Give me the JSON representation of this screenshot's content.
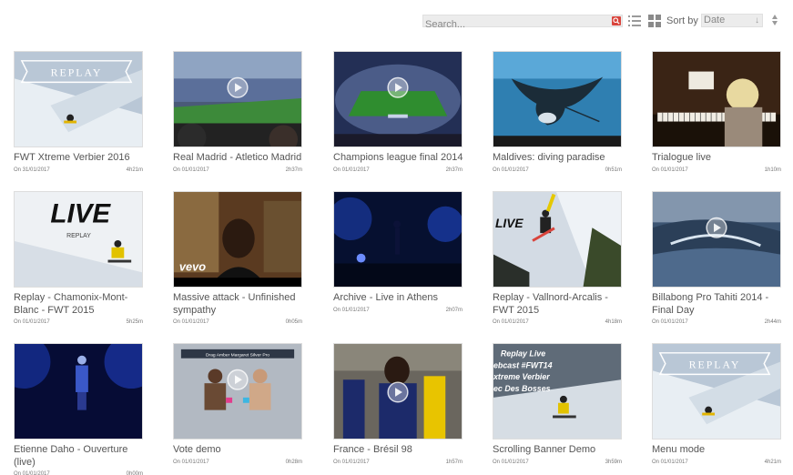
{
  "toolbar": {
    "search_placeholder": "Search...",
    "sort_label": "Sort by",
    "sort_value": "Date",
    "search_icon": "search-icon",
    "list_icon": "list-view-icon",
    "grid_icon": "grid-view-icon",
    "order_icon": "sort-order-icon",
    "accent": "#d9443c"
  },
  "videos": [
    {
      "title": "FWT Xtreme Verbier 2016",
      "date": "On 31/01/2017",
      "duration": "4h21m",
      "thumb": "ski-replay"
    },
    {
      "title": "Real Madrid - Atletico Madrid",
      "date": "On 01/01/2017",
      "duration": "2h37m",
      "thumb": "stadium"
    },
    {
      "title": "Champions league final 2014",
      "date": "On 01/01/2017",
      "duration": "2h37m",
      "thumb": "stadium-field"
    },
    {
      "title": "Maldives: diving paradise",
      "date": "On 01/01/2017",
      "duration": "0h51m",
      "thumb": "manta-ray"
    },
    {
      "title": "Trialogue live",
      "date": "On 01/01/2017",
      "duration": "1h10m",
      "thumb": "piano"
    },
    {
      "title": "Replay - Chamonix-Mont-Blanc - FWT 2015",
      "date": "On 01/01/2017",
      "duration": "5h25m",
      "thumb": "live-replay"
    },
    {
      "title": "Massive attack - Unfinished sympathy",
      "date": "On 01/01/2017",
      "duration": "0h05m",
      "thumb": "vevo"
    },
    {
      "title": "Archive - Live in Athens",
      "date": "On 01/01/2017",
      "duration": "2h07m",
      "thumb": "concert"
    },
    {
      "title": "Replay - Vallnord-Arcalis - FWT 2015",
      "date": "On 01/01/2017",
      "duration": "4h18m",
      "thumb": "ski-live"
    },
    {
      "title": "Billabong Pro Tahiti 2014 - Final Day",
      "date": "On 01/01/2017",
      "duration": "2h44m",
      "thumb": "wave"
    },
    {
      "title": "Etienne Daho - Ouverture (live)",
      "date": "On 01/01/2017",
      "duration": "0h00m",
      "thumb": "stage-blue"
    },
    {
      "title": "Vote demo",
      "date": "On 01/01/2017",
      "duration": "0h28m",
      "thumb": "vote"
    },
    {
      "title": "France - Brésil 98",
      "date": "On 01/01/2017",
      "duration": "1h57m",
      "thumb": "football"
    },
    {
      "title": "Scrolling Banner Demo",
      "date": "On 01/01/2017",
      "duration": "3h59m",
      "thumb": "banner"
    },
    {
      "title": "Menu mode",
      "date": "On 01/01/2017",
      "duration": "4h21m",
      "thumb": "ski-replay"
    }
  ],
  "thumb_text": {
    "replay": "REPLAY",
    "live": "LIVE",
    "replay_small": "REPLAY",
    "vevo": "vevo",
    "vote_banner": "Drag Amber Margaret Silver Pro",
    "banner_lines": [
      "Replay Live",
      "ebcast #FWT14",
      "xtreme Verbier",
      "ec Des Bosses"
    ]
  }
}
